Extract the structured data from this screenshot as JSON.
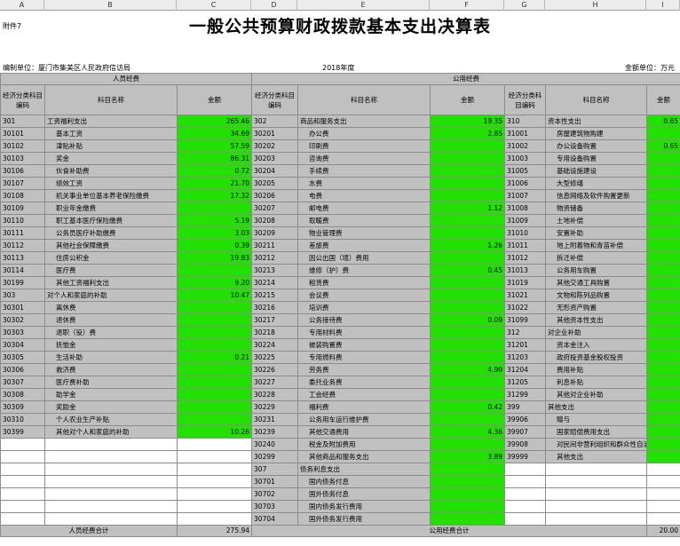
{
  "col_letters": [
    "A",
    "B",
    "C",
    "D",
    "E",
    "F",
    "G",
    "H",
    "I"
  ],
  "annex": "附件7",
  "title": "一般公共预算财政拨款基本支出决算表",
  "unit_left": "编制单位：厦门市集美区人民政府信访局",
  "year": "2018年度",
  "unit_right": "金额单位：万元",
  "group_personnel": "人员经费",
  "group_public": "公用经费",
  "col_code": "经济分类科目编码",
  "col_name": "科目名称",
  "col_amount": "金额",
  "rows": [
    {
      "c1": "301",
      "n1": "工资福利支出",
      "a1": "265.46",
      "c2": "302",
      "n2": "商品和服务支出",
      "a2": "19.35",
      "c3": "310",
      "n3": "资本性支出",
      "a3": "0.65"
    },
    {
      "c1": "30101",
      "n1": "基本工资",
      "a1": "34.69",
      "c2": "30201",
      "n2": "办公费",
      "a2": "2.85",
      "c3": "31001",
      "n3": "房屋建筑物购建",
      "a3": ""
    },
    {
      "c1": "30102",
      "n1": "津贴补贴",
      "a1": "57.59",
      "c2": "30202",
      "n2": "印刷费",
      "a2": "",
      "c3": "31002",
      "n3": "办公设备购置",
      "a3": "0.65"
    },
    {
      "c1": "30103",
      "n1": "奖金",
      "a1": "86.31",
      "c2": "30203",
      "n2": "咨询费",
      "a2": "",
      "c3": "31003",
      "n3": "专用设备购置",
      "a3": ""
    },
    {
      "c1": "30106",
      "n1": "伙食补助费",
      "a1": "0.72",
      "c2": "30204",
      "n2": "手续费",
      "a2": "",
      "c3": "31005",
      "n3": "基础设施建设",
      "a3": ""
    },
    {
      "c1": "30107",
      "n1": "绩效工资",
      "a1": "21.70",
      "c2": "30205",
      "n2": "水费",
      "a2": "",
      "c3": "31006",
      "n3": "大型修缮",
      "a3": ""
    },
    {
      "c1": "30108",
      "n1": "机关事业单位基本养老保险缴费",
      "a1": "17.32",
      "c2": "30206",
      "n2": "电费",
      "a2": "",
      "c3": "31007",
      "n3": "信息网络及软件购置更新",
      "a3": ""
    },
    {
      "c1": "30109",
      "n1": "职业年金缴费",
      "a1": "",
      "c2": "30207",
      "n2": "邮电费",
      "a2": "1.12",
      "c3": "31008",
      "n3": "物资储备",
      "a3": ""
    },
    {
      "c1": "30110",
      "n1": "职工基本医疗保险缴费",
      "a1": "5.19",
      "c2": "30208",
      "n2": "取暖费",
      "a2": "",
      "c3": "31009",
      "n3": "土地补偿",
      "a3": ""
    },
    {
      "c1": "30111",
      "n1": "公务员医疗补助缴费",
      "a1": "3.03",
      "c2": "30209",
      "n2": "物业管理费",
      "a2": "",
      "c3": "31010",
      "n3": "安置补助",
      "a3": ""
    },
    {
      "c1": "30112",
      "n1": "其他社会保障缴费",
      "a1": "0.39",
      "c2": "30211",
      "n2": "差旅费",
      "a2": "1.26",
      "c3": "31011",
      "n3": "地上附着物和青苗补偿",
      "a3": ""
    },
    {
      "c1": "30113",
      "n1": "住房公积金",
      "a1": "19.83",
      "c2": "30212",
      "n2": "因公出国（境）费用",
      "a2": "",
      "c3": "31012",
      "n3": "拆迁补偿",
      "a3": ""
    },
    {
      "c1": "30114",
      "n1": "医疗费",
      "a1": "",
      "c2": "30213",
      "n2": "维修（护）费",
      "a2": "0.45",
      "c3": "31013",
      "n3": "公务用车购置",
      "a3": ""
    },
    {
      "c1": "30199",
      "n1": "其他工资福利支出",
      "a1": "9.20",
      "c2": "30214",
      "n2": "租赁费",
      "a2": "",
      "c3": "31019",
      "n3": "其他交通工具购置",
      "a3": ""
    },
    {
      "c1": "303",
      "n1": "对个人和家庭的补助",
      "a1": "10.47",
      "c2": "30215",
      "n2": "会议费",
      "a2": "",
      "c3": "31021",
      "n3": "文物和陈列品购置",
      "a3": ""
    },
    {
      "c1": "30301",
      "n1": "离休费",
      "a1": "",
      "c2": "30216",
      "n2": "培训费",
      "a2": "",
      "c3": "31022",
      "n3": "无形资产购置",
      "a3": ""
    },
    {
      "c1": "30302",
      "n1": "退休费",
      "a1": "",
      "c2": "30217",
      "n2": "公务接待费",
      "a2": "0.09",
      "c3": "31099",
      "n3": "其他资本性支出",
      "a3": ""
    },
    {
      "c1": "30303",
      "n1": "退职（役）费",
      "a1": "",
      "c2": "30218",
      "n2": "专用材料费",
      "a2": "",
      "c3": "312",
      "n3": "对企业补助",
      "a3": ""
    },
    {
      "c1": "30304",
      "n1": "抚恤金",
      "a1": "",
      "c2": "30224",
      "n2": "被装购置费",
      "a2": "",
      "c3": "31201",
      "n3": "资本金注入",
      "a3": ""
    },
    {
      "c1": "30305",
      "n1": "生活补助",
      "a1": "0.21",
      "c2": "30225",
      "n2": "专用燃料费",
      "a2": "",
      "c3": "31203",
      "n3": "政府投资基金股权投资",
      "a3": ""
    },
    {
      "c1": "30306",
      "n1": "救济费",
      "a1": "",
      "c2": "30226",
      "n2": "劳务费",
      "a2": "4.90",
      "c3": "31204",
      "n3": "费用补贴",
      "a3": ""
    },
    {
      "c1": "30307",
      "n1": "医疗费补助",
      "a1": "",
      "c2": "30227",
      "n2": "委托业务费",
      "a2": "",
      "c3": "31205",
      "n3": "利息补贴",
      "a3": ""
    },
    {
      "c1": "30308",
      "n1": "助学金",
      "a1": "",
      "c2": "30228",
      "n2": "工会经费",
      "a2": "",
      "c3": "31299",
      "n3": "其他对企业补助",
      "a3": ""
    },
    {
      "c1": "30309",
      "n1": "奖励金",
      "a1": "",
      "c2": "30229",
      "n2": "福利费",
      "a2": "0.42",
      "c3": "399",
      "n3": "其他支出",
      "a3": ""
    },
    {
      "c1": "30310",
      "n1": "个人农业生产补贴",
      "a1": "",
      "c2": "30231",
      "n2": "公务用车运行维护费",
      "a2": "",
      "c3": "39906",
      "n3": "赠与",
      "a3": ""
    },
    {
      "c1": "30399",
      "n1": "其他对个人和家庭的补助",
      "a1": "10.26",
      "c2": "30239",
      "n2": "其他交通费用",
      "a2": "4.36",
      "c3": "39907",
      "n3": "国家赔偿费用支出",
      "a3": ""
    },
    {
      "c1": "",
      "n1": "",
      "a1": "",
      "c2": "30240",
      "n2": "税金及附加费用",
      "a2": "",
      "c3": "39908",
      "n3": "对民间非营利组织和群众性自治组织补贴",
      "a3": ""
    },
    {
      "c1": "",
      "n1": "",
      "a1": "",
      "c2": "30299",
      "n2": "其他商品和服务支出",
      "a2": "3.89",
      "c3": "39999",
      "n3": "其他支出",
      "a3": ""
    },
    {
      "c1": "",
      "n1": "",
      "a1": "",
      "c2": "307",
      "n2": "债务利息支出",
      "a2": "",
      "c3": "",
      "n3": "",
      "a3": ""
    },
    {
      "c1": "",
      "n1": "",
      "a1": "",
      "c2": "30701",
      "n2": "国内债务付息",
      "a2": "",
      "c3": "",
      "n3": "",
      "a3": ""
    },
    {
      "c1": "",
      "n1": "",
      "a1": "",
      "c2": "30702",
      "n2": "国外债务付息",
      "a2": "",
      "c3": "",
      "n3": "",
      "a3": ""
    },
    {
      "c1": "",
      "n1": "",
      "a1": "",
      "c2": "30703",
      "n2": "国内债务发行费用",
      "a2": "",
      "c3": "",
      "n3": "",
      "a3": ""
    },
    {
      "c1": "",
      "n1": "",
      "a1": "",
      "c2": "30704",
      "n2": "国外债务发行费用",
      "a2": "",
      "c3": "",
      "n3": "",
      "a3": ""
    }
  ],
  "total_personnel_label": "人员经费合计",
  "total_personnel_value": "275.94",
  "total_public_label": "公用经费合计",
  "total_public_value": "20.00"
}
